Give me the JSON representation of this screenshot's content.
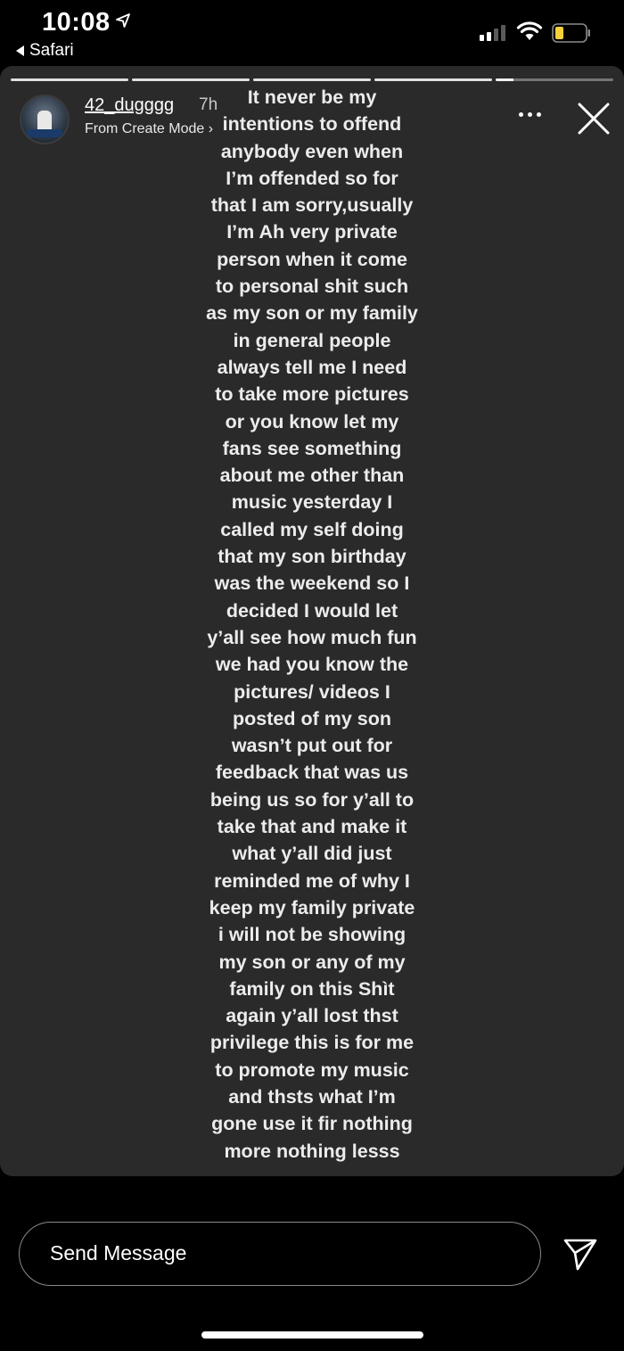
{
  "status_bar": {
    "time": "10:08",
    "back_app": "Safari",
    "signal_bars": 2
  },
  "story": {
    "username": "42_dugggg",
    "time_ago": "7h",
    "subtitle": "From Create Mode ›",
    "segments": 5,
    "current_segment_progress": 0.15,
    "caption": "It never be my\nintentions to offend\nanybody even when\nI’m offended so for\nthat I am sorry,usually\nI’m Ah very private\nperson when it come\nto personal shit such\nas my son or my family\nin general people\nalways tell me I need\nto take more pictures\nor you know let my\nfans see something\nabout me other than\nmusic yesterday I\ncalled my self doing\nthat my son birthday\nwas the weekend so I\ndecided I would let\ny’all see how much fun\nwe had you know the\npictures/ videos I\nposted of my son\nwasn’t put out for\nfeedback that was us\nbeing us so for y’all to\ntake that and make it\nwhat y’all did just\nreminded me of why I\nkeep my family private\ni will not be showing\nmy son or any of my\nfamily on this Shìt\nagain y’all lost thst\nprivilege this is for me\nto promote my music\nand thsts what I’m\ngone use it fir nothing\nmore nothing lesss"
  },
  "reply": {
    "label": "Send Message"
  },
  "colors": {
    "background": "#000000",
    "story_background": "#2a2a2a",
    "battery_level": "#f5d23a"
  }
}
